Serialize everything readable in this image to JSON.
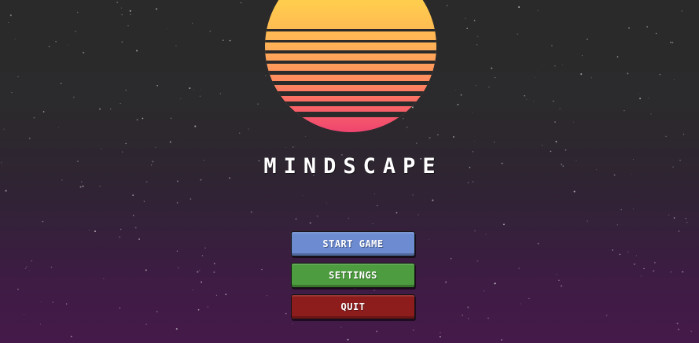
{
  "game": {
    "title": "MINDSCAPE"
  },
  "menu": {
    "start_label": "START GAME",
    "settings_label": "SETTINGS",
    "quit_label": "QUIT"
  },
  "colors": {
    "sun_top": "#ffd84a",
    "sun_bottom": "#ef456f",
    "background_top": "#2a2a2a",
    "background_bottom": "#451a4a",
    "start_button": "#6c8bd0",
    "settings_button": "#4d9c3f",
    "quit_button": "#8d1c1c"
  }
}
